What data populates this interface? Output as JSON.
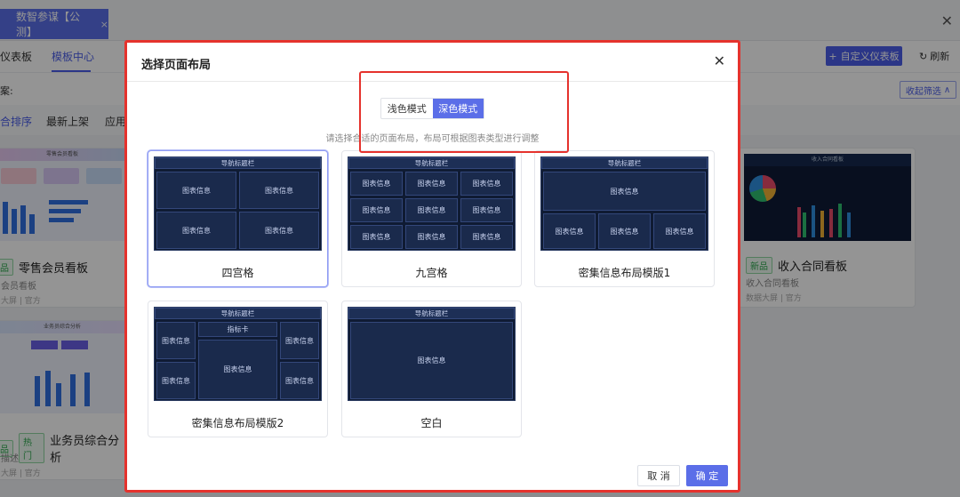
{
  "app": {
    "tab_label": "数智参谋【公测】"
  },
  "nav": {
    "dashboard": "仪表板",
    "template_center": "模板中心",
    "custom_button": "自定义仪表板",
    "refresh": "刷新"
  },
  "filter": {
    "label": "案:",
    "collapse": "收起筛选"
  },
  "sort": {
    "items": [
      "合排序",
      "最新上架",
      "应用"
    ]
  },
  "cards": [
    {
      "title": "零售会员看板",
      "tag": "品",
      "sub": "会员看板",
      "meta": "大屏 | 官方",
      "thumb_title": "零售会员看板"
    },
    {
      "title": "业务员综合分析",
      "tag": "品",
      "tag2": "热门",
      "sub": "描述",
      "meta": "大屏 | 官方",
      "thumb_title": "业务员综合分析"
    },
    {
      "title": "收入合同看板",
      "tag": "新品",
      "sub": "收入合同看板",
      "meta": "数据大屏 | 官方",
      "thumb_title": "收入合同看板"
    }
  ],
  "modal": {
    "title": "选择页面布局",
    "mode_light": "浅色模式",
    "mode_dark": "深色模式",
    "hint": "请选择合适的页面布局，布局可根据图表类型进行调整",
    "nav_bar": "导航标题栏",
    "chart_info": "图表信息",
    "indicator_card": "指标卡",
    "layouts": [
      "四宫格",
      "九宫格",
      "密集信息布局模版1",
      "密集信息布局模版2",
      "空白"
    ],
    "cancel": "取 消",
    "confirm": "确 定"
  },
  "colors": {
    "accent": "#5b6ee8",
    "highlight": "#e5322d",
    "preview_bg": "#0f1b33"
  }
}
